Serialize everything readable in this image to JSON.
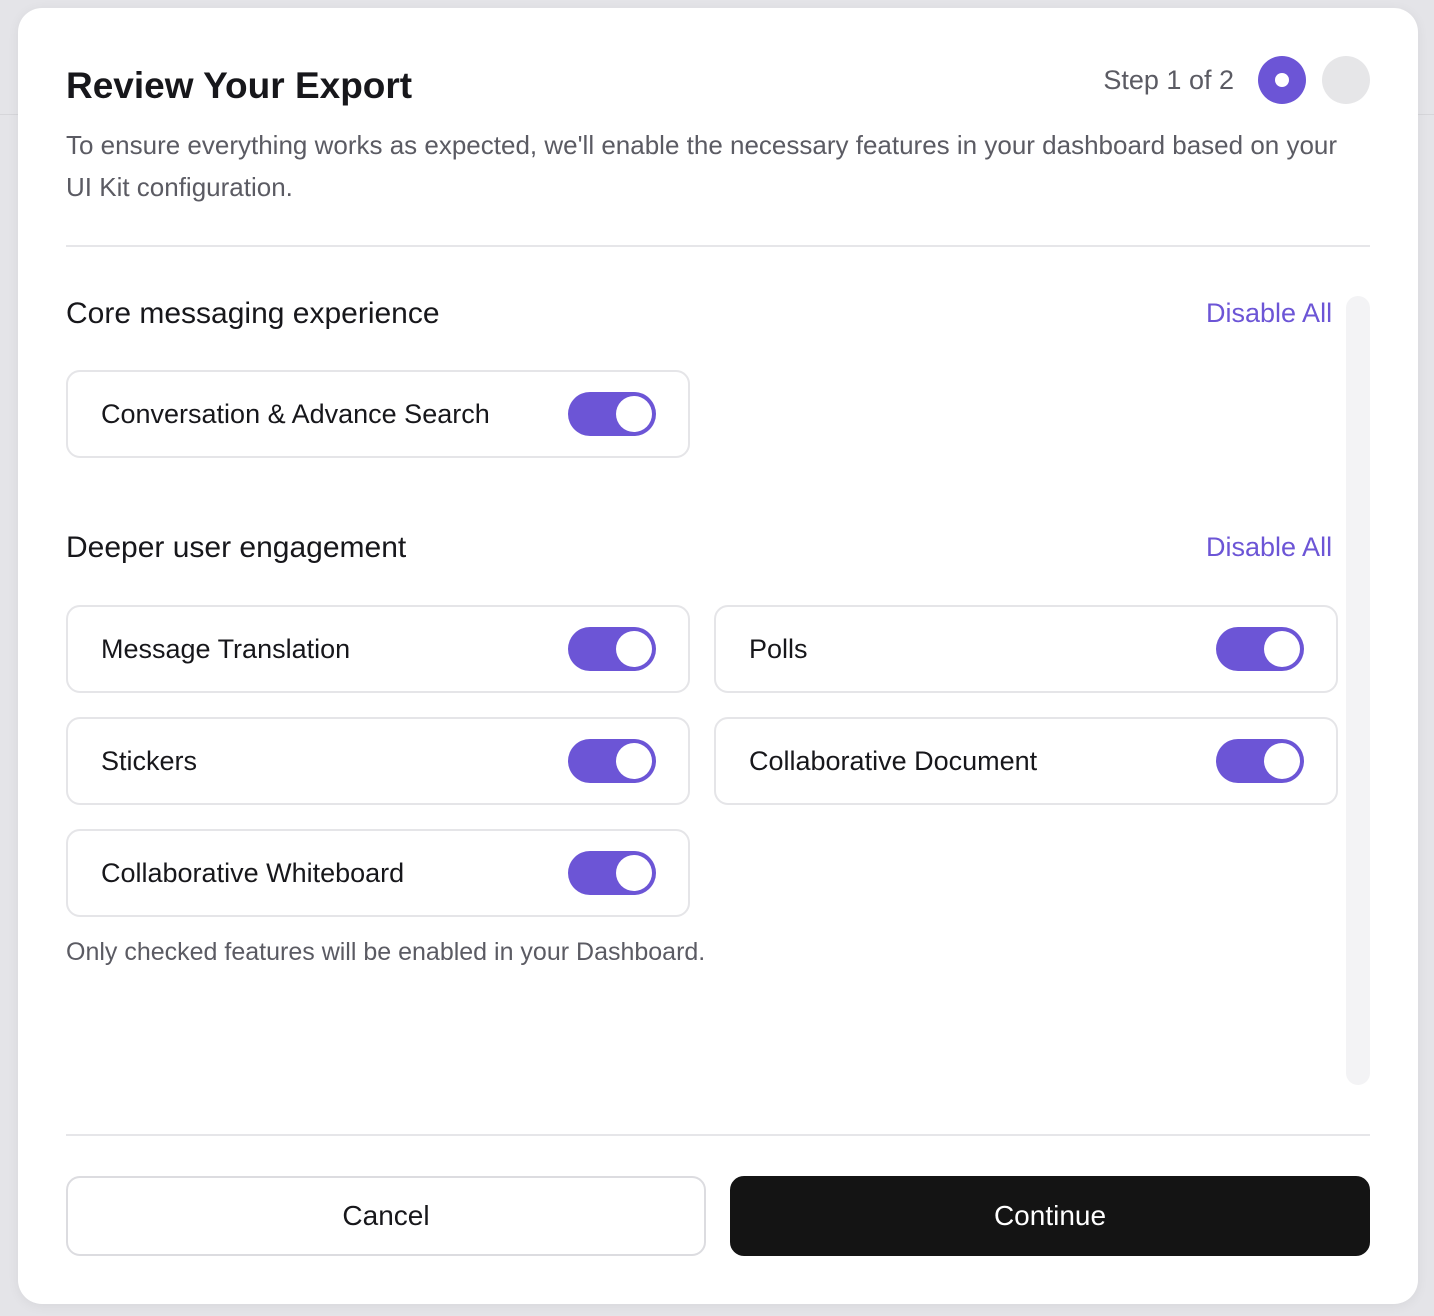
{
  "modal": {
    "title": "Review Your Export",
    "step_label": "Step 1 of 2",
    "total_steps": 2,
    "current_step": 1,
    "description": "To ensure everything works as expected, we'll enable the necessary features in your dashboard based on your UI Kit configuration."
  },
  "sections": [
    {
      "title": "Core messaging experience",
      "action_label": "Disable All",
      "features": [
        {
          "label": "Conversation & Advance Search",
          "enabled": true
        }
      ]
    },
    {
      "title": "Deeper user engagement",
      "action_label": "Disable All",
      "features": [
        {
          "label": "Message Translation",
          "enabled": true
        },
        {
          "label": "Polls",
          "enabled": true
        },
        {
          "label": "Stickers",
          "enabled": true
        },
        {
          "label": "Collaborative Document",
          "enabled": true
        },
        {
          "label": "Collaborative Whiteboard",
          "enabled": true
        }
      ]
    }
  ],
  "footnote": "Only checked features will be enabled in your Dashboard.",
  "buttons": {
    "cancel": "Cancel",
    "continue": "Continue"
  },
  "colors": {
    "accent": "#6c55d6",
    "primary_button": "#141414",
    "toggle_off": "#e6e6e8"
  }
}
